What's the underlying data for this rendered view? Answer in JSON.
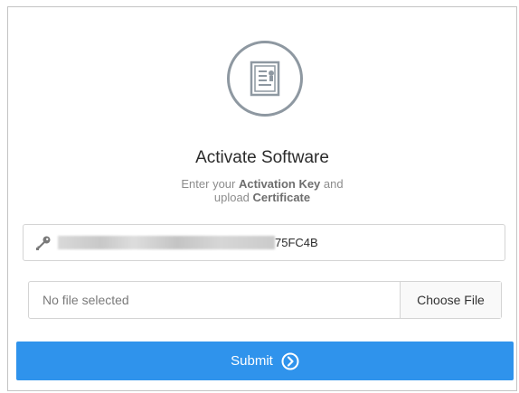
{
  "dialog": {
    "icon": "certificate-icon",
    "title": "Activate Software",
    "subtitle": {
      "pre": "Enter your ",
      "key_term": "Activation Key",
      "mid": " and",
      "line2_pre": "upload ",
      "cert_term": "Certificate"
    }
  },
  "activation_key": {
    "icon": "key-icon",
    "visible_suffix": "75FC4B"
  },
  "certificate_upload": {
    "status": "No file selected",
    "button_label": "Choose File"
  },
  "submit": {
    "label": "Submit",
    "icon": "chevron-right-circle-icon",
    "color": "#2f93ec"
  }
}
